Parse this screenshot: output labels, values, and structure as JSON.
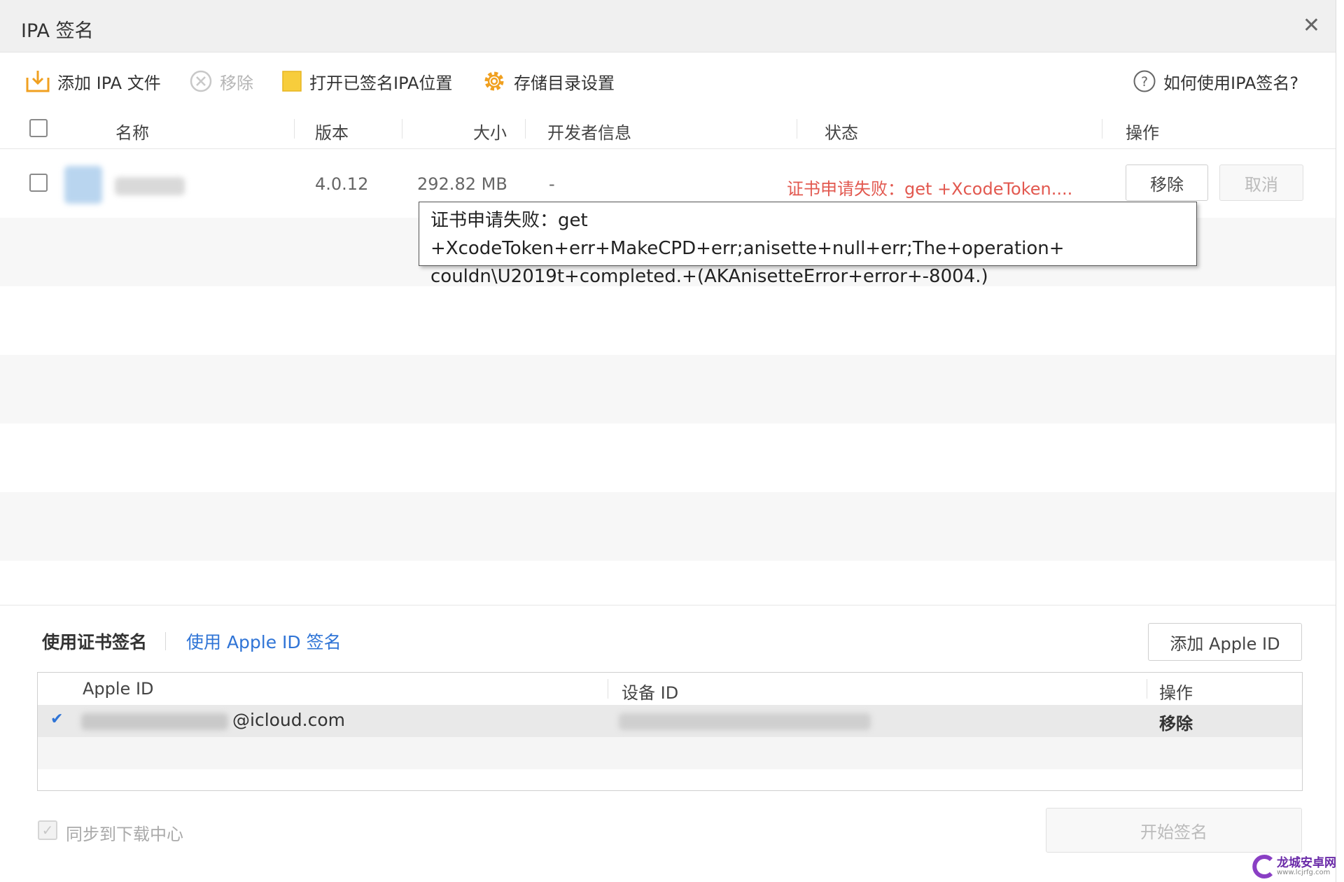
{
  "window": {
    "title": "IPA 签名"
  },
  "toolbar": {
    "add_ipa": "添加 IPA 文件",
    "remove": "移除",
    "open_signed": "打开已签名IPA位置",
    "storage_settings": "存储目录设置",
    "help": "如何使用IPA签名?"
  },
  "table": {
    "headers": {
      "name": "名称",
      "version": "版本",
      "size": "大小",
      "developer": "开发者信息",
      "status": "状态",
      "action": "操作"
    },
    "rows": [
      {
        "version": "4.0.12",
        "size": "292.82 MB",
        "developer": "-",
        "status": "证书申请失败：get +XcodeToken....",
        "remove": "移除",
        "cancel": "取消"
      }
    ]
  },
  "tooltip": {
    "line1": "证书申请失败：get +XcodeToken+err+MakeCPD+err;anisette+null+err;The+operation+",
    "line2": "couldn\\U2019t+completed.+(AKAnisetteError+error+-8004.)"
  },
  "signing": {
    "tab_cert": "使用证书签名",
    "tab_appleid": "使用 Apple ID 签名",
    "add_appleid": "添加 Apple ID",
    "columns": {
      "apple_id": "Apple ID",
      "device_id": "设备 ID",
      "action": "操作"
    },
    "accounts": [
      {
        "email_suffix": "@icloud.com",
        "action": "移除",
        "checkmark": "✔"
      }
    ]
  },
  "footer": {
    "sync_label": "同步到下载中心",
    "start_sign": "开始签名"
  },
  "watermark": {
    "text": "龙城安卓网",
    "sub": "www.lcjrfg.com"
  },
  "colors": {
    "error": "#e2584f",
    "link": "#2f74d6",
    "accent": "#f0a020"
  }
}
